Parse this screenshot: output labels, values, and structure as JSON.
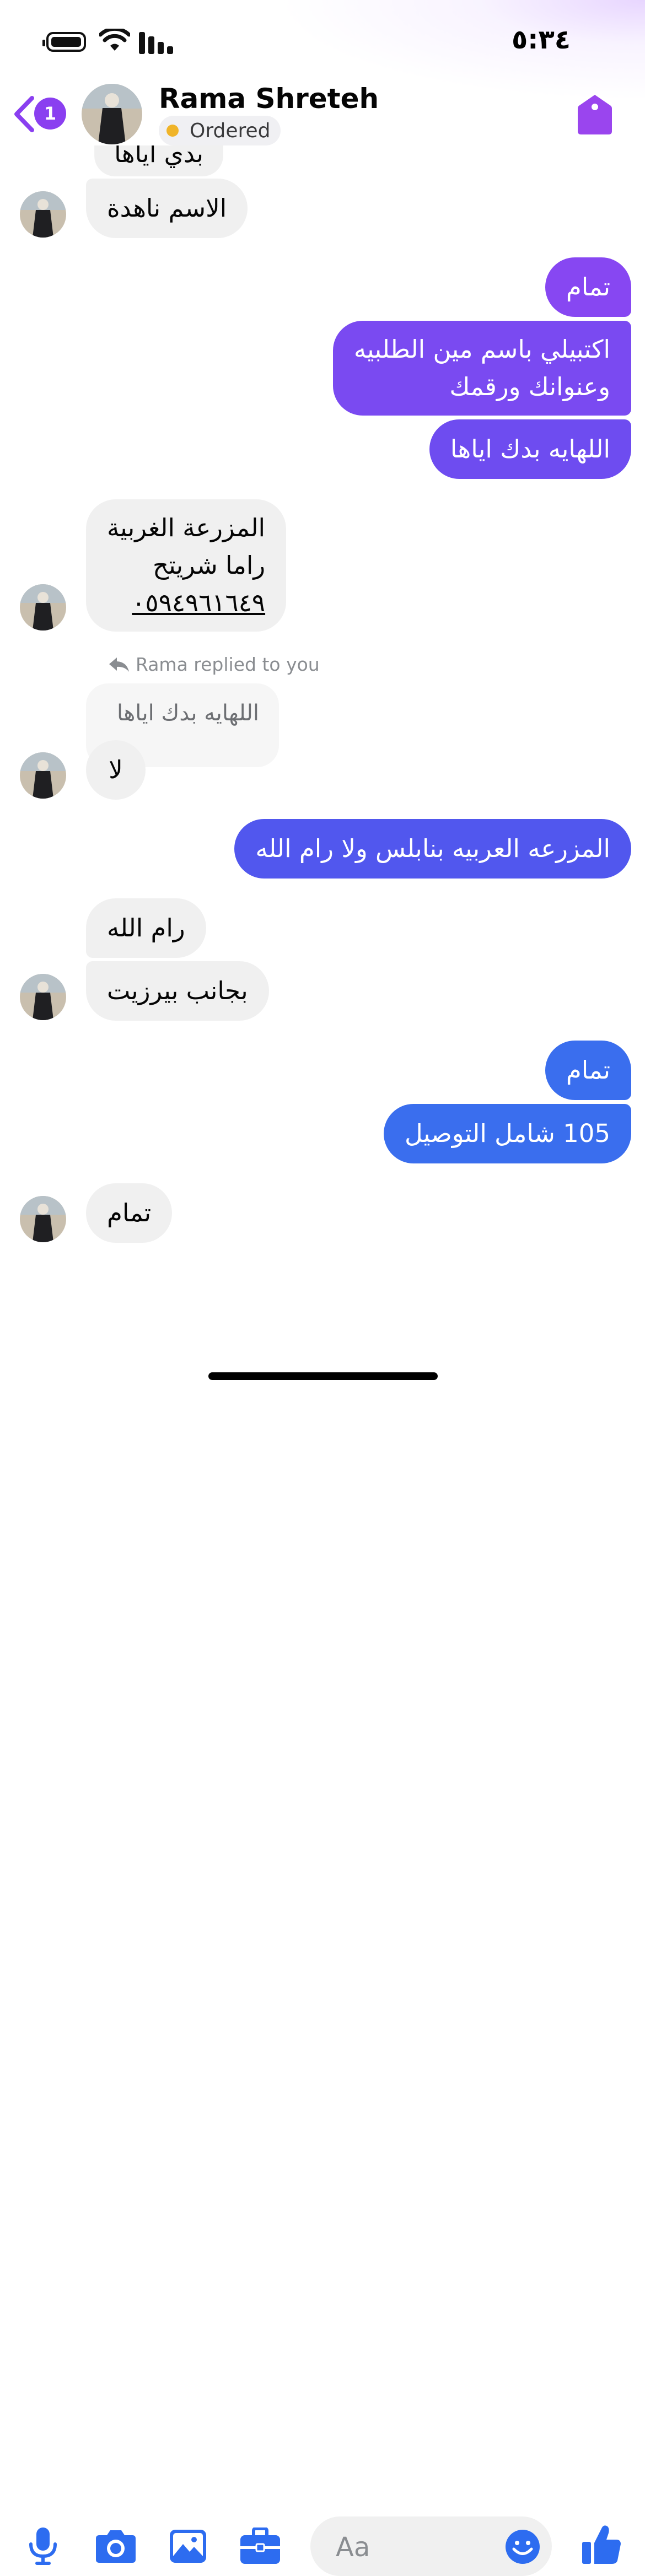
{
  "status_bar": {
    "time": "٥:٣٤"
  },
  "header": {
    "back_badge": "1",
    "contact_name": "Rama Shreteh",
    "status_label": "Ordered",
    "colors": {
      "accent": "#8a3ff0",
      "status_dot": "#f0b429"
    }
  },
  "messages": [
    {
      "id": "m0",
      "sender": "contact",
      "text": "بدي اياها"
    },
    {
      "id": "m1",
      "sender": "contact",
      "text": "الاسم ناهدة"
    },
    {
      "id": "m2",
      "sender": "me",
      "text": "تمام"
    },
    {
      "id": "m3",
      "sender": "me",
      "lines": [
        "اكتبيلي باسم مين الطلبيه",
        "وعنوانك ورقمك"
      ]
    },
    {
      "id": "m4",
      "sender": "me",
      "text": "اللهايه بدك اياها"
    },
    {
      "id": "m5",
      "sender": "contact",
      "lines": [
        "المزرعة الغربية",
        "راما شريتح",
        "٠٥٩٤٩٦١٦٤٩"
      ]
    },
    {
      "id": "m6",
      "sender": "contact",
      "reply_label": "Rama replied to you",
      "quoted_text": "اللهايه بدك اياها",
      "text": "لا"
    },
    {
      "id": "m7",
      "sender": "me",
      "text": "المزرعه العربيه بنابلس ولا رام الله"
    },
    {
      "id": "m8",
      "sender": "contact",
      "text": "رام الله"
    },
    {
      "id": "m9",
      "sender": "contact",
      "text": "بجانب بيرزيت"
    },
    {
      "id": "m10",
      "sender": "me",
      "text": "تمام"
    },
    {
      "id": "m11",
      "sender": "me",
      "text": "105 شامل التوصيل"
    },
    {
      "id": "m12",
      "sender": "contact",
      "text": "تمام"
    }
  ],
  "composer": {
    "placeholder": "Aa",
    "icons": [
      "microphone-icon",
      "camera-icon",
      "image-icon",
      "briefcase-icon",
      "emoji-icon",
      "thumbs-up-icon"
    ],
    "icon_color": "#2d6cf0"
  },
  "bubble_colors": {
    "incoming": "#f0f0f0",
    "outgoing_top": "#8747f2",
    "outgoing_mid": "#5157ee",
    "outgoing_bottom": "#3a6eee"
  }
}
